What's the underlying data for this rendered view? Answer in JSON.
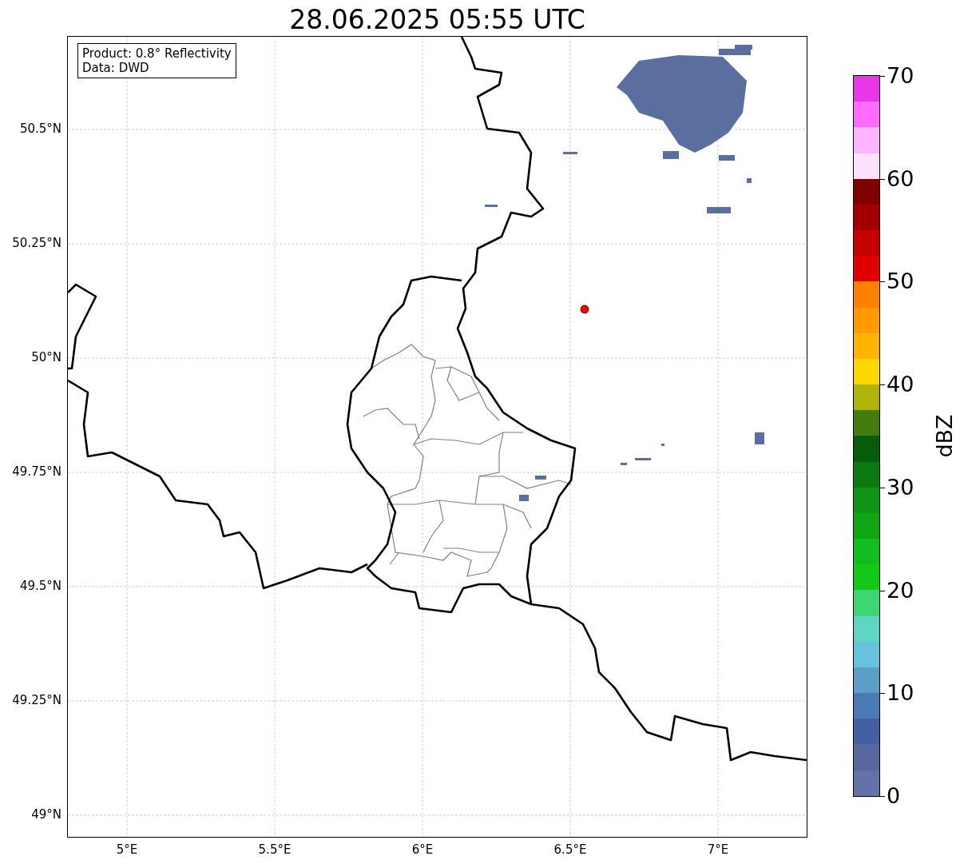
{
  "title": "28.06.2025 05:55 UTC",
  "info_box": {
    "lines": [
      "Product: 0.8° Reflectivity",
      "Data: DWD"
    ]
  },
  "map": {
    "lat_ticks": [
      "50.5°N",
      "50.25°N",
      "50°N",
      "49.75°N",
      "49.5°N",
      "49.25°N",
      "49°N"
    ],
    "lon_ticks": [
      "5°E",
      "5.5°E",
      "6°E",
      "6.5°E",
      "7°E"
    ]
  },
  "colorbar": {
    "label": "dBZ",
    "ticks": [
      "70",
      "60",
      "50",
      "40",
      "30",
      "20",
      "10",
      "0"
    ],
    "bands": [
      {
        "color": "#e836e8"
      },
      {
        "color": "#ff6aff"
      },
      {
        "color": "#ffb4ff"
      },
      {
        "color": "#ffe0ff"
      },
      {
        "color": "#800000"
      },
      {
        "color": "#a20000"
      },
      {
        "color": "#c40000"
      },
      {
        "color": "#e00000"
      },
      {
        "color": "#ff7f00"
      },
      {
        "color": "#ff9a00"
      },
      {
        "color": "#ffb400"
      },
      {
        "color": "#ffd700"
      },
      {
        "color": "#b0b30a"
      },
      {
        "color": "#457a0c"
      },
      {
        "color": "#065c0a"
      },
      {
        "color": "#0b7a12"
      },
      {
        "color": "#0f9416"
      },
      {
        "color": "#10a613"
      },
      {
        "color": "#12bd1f"
      },
      {
        "color": "#12c918"
      },
      {
        "color": "#3dd672"
      },
      {
        "color": "#5fd6c4"
      },
      {
        "color": "#66c2dd"
      },
      {
        "color": "#5b9ec7"
      },
      {
        "color": "#4a7bb4"
      },
      {
        "color": "#4360a3"
      },
      {
        "color": "#5667a0"
      },
      {
        "color": "#6373a8"
      }
    ]
  }
}
